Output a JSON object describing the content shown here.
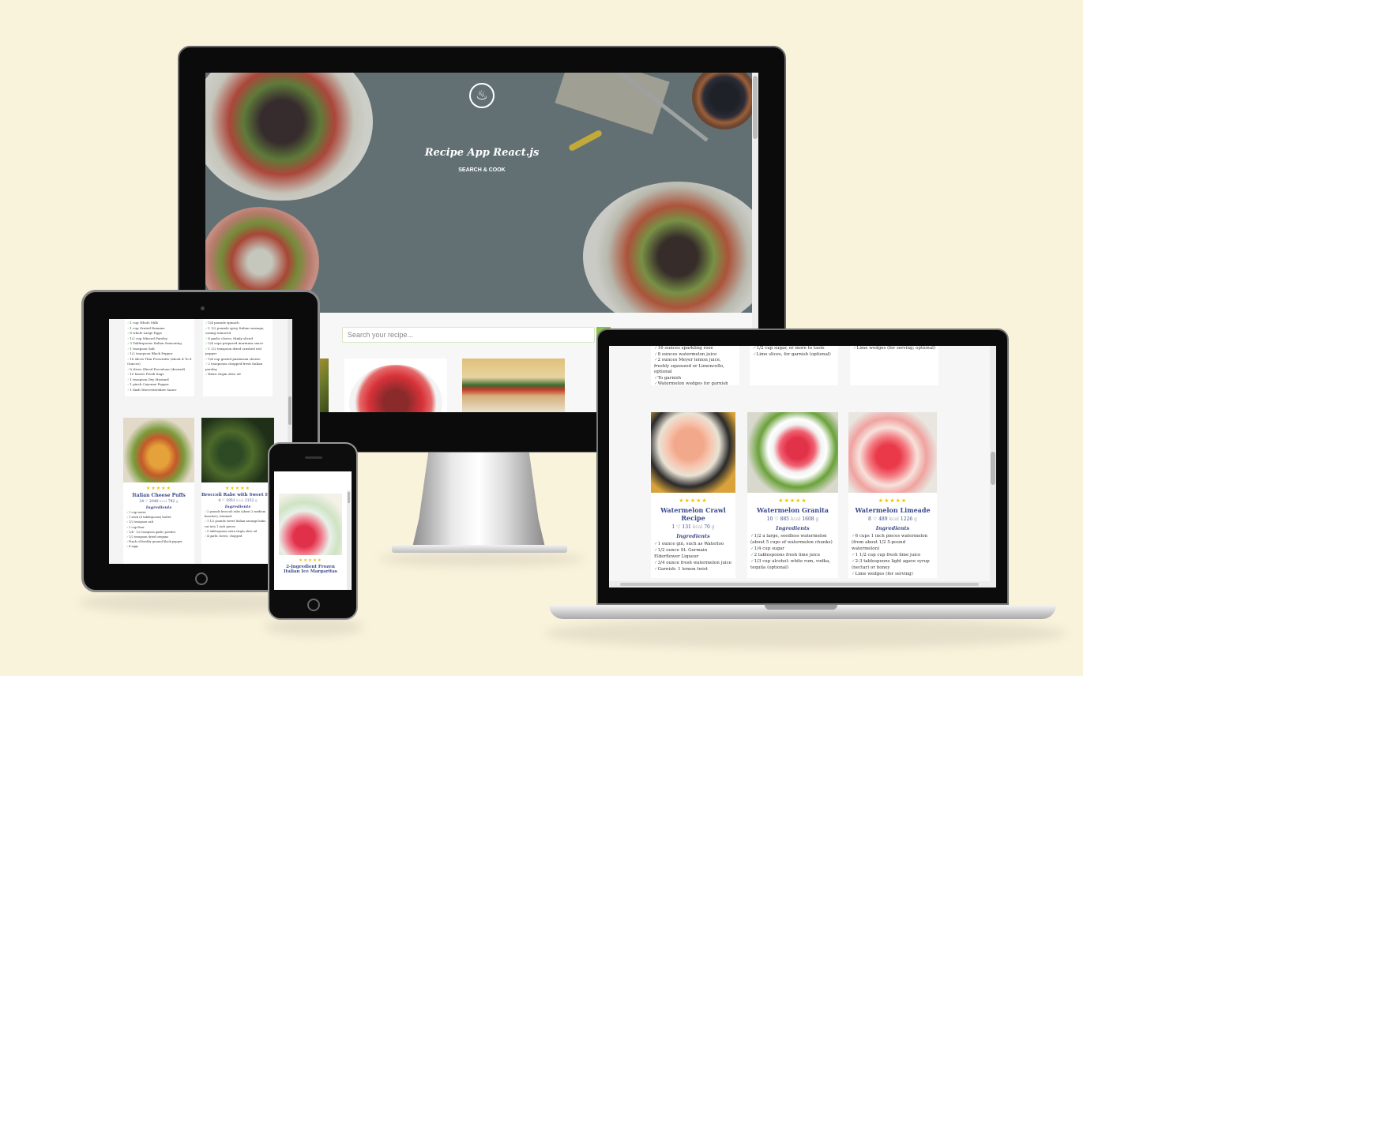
{
  "app": {
    "title": "Recipe App React.js",
    "subtitle": "SEARCH & COOK",
    "logo_icon": "fork-knife-icon"
  },
  "search": {
    "placeholder": "Search your recipe..."
  },
  "colors": {
    "background": "#faf3dc",
    "accent": "#8bc34a",
    "title_color": "#3b4a8a",
    "star_color": "#f2c200",
    "check_color": "#5cb85c"
  },
  "common": {
    "stars": "★★★★★",
    "ingredients_heading": "Ingredients",
    "cal_label": "kcal",
    "unit": "g",
    "heart": "♡"
  },
  "laptop": {
    "top_cards": [
      [
        "16 ounces sparkling rosé",
        "8 ounces watermelon juice",
        "2 ounces Meyer lemon juice, freshly squeezed or Limoncello, optional",
        "To garnish",
        "Watermelon wedges for garnish"
      ],
      [
        "1/2 cup sugar, or more to taste",
        "Lime slices, for garnish (optional)"
      ],
      [
        "Lime wedges (for serving; optional)"
      ]
    ],
    "recipes": [
      {
        "title": "Watermelon Crawl Recipe",
        "servings": "1",
        "likes": "131",
        "kcal": "70",
        "ingredients": [
          "1 ounce gin, such as Waterloo",
          "1/2 ounce St. Germain Elderflower Liqueur",
          "3/4 ounce fresh watermelon juice",
          "Garnish: 1 lemon twist"
        ]
      },
      {
        "title": "Watermelon Granita",
        "servings": "10",
        "likes": "885",
        "kcal": "1608",
        "ingredients": [
          "1/2 a large, seedless watermelon (about 5 cups of watermelon chunks)",
          "1/4 cup sugar",
          "2 tablespoons fresh lime juice",
          "1/3 cup alcohol: white rum, vodka, tequila (optional)"
        ]
      },
      {
        "title": "Watermelon Limeade",
        "servings": "8",
        "likes": "489",
        "kcal": "1226",
        "ingredients": [
          "6 cups 1 inch pieces watermelon (from about 1/2 5-pound watermelon)",
          "1 1/2 cup cup fresh lime juice",
          "2-3 tablespoons light agave syrup (nectar) or honey",
          "Lime wedges (for serving)"
        ]
      }
    ]
  },
  "ipad": {
    "top_left_list": [
      "1 cup Whole Milk",
      "1 cup Grated Romano",
      "8 whole Large Eggs",
      "1/2 cup Minced Parsley",
      "3 Tablespoons Italian Seasoning",
      "1 teaspoon Salt",
      "1/2 teaspoon Black Pepper",
      "16 slices Thin Prosciutto (about 4 To 6 Ounces)",
      "8 slices Sliced Provolone (desired)",
      "10 leaves Fresh Sage",
      "1 teaspoon Dry Mustard",
      "1 pinch Cayenne Pepper",
      "1 dash Worcestershire Sauce"
    ],
    "top_right_list": [
      "1/4 pounds spinach",
      "1 1/2 pounds spicy Italian sausage, casing removed",
      "4 garlic cloves, thinly sliced",
      "1/4 cups prepared marinara sauce",
      "1 1/2 teaspoon dried crushed red pepper",
      "1/4 cup grated parmesan cheese",
      "2 teaspoons chopped fresh Italian parsley",
      "Extra virgin olive oil"
    ],
    "recipes": [
      {
        "title": "Italian Cheese Puffs",
        "servings": "24",
        "likes": "2040",
        "kcal": "782",
        "ingredients": [
          "1 cup water",
          "1 stick (8 tablespoons) butter",
          "1/2 teaspoon salt",
          "1 cup flour",
          "1/4 - 1/2 teaspoon garlic powder",
          "1/2 teaspoon dried oregano",
          "Pinch of freshly ground black pepper",
          "4 eggs"
        ]
      },
      {
        "title": "Broccoli Rabe with Sweet Italian Sausage",
        "servings": "4",
        "likes": "1951",
        "kcal": "2152",
        "ingredients": [
          "2 pounds broccoli rabe (about 2 medium bunches), trimmed",
          "1 1/2 pounds sweet Italian sausage links, cut into 1 inch pieces",
          "5 tablespoons extra virgin olive oil",
          "4 garlic cloves, chopped"
        ]
      }
    ]
  },
  "iphone": {
    "recipe_title": "2-Ingredient Frozen Italian Ice Margaritas"
  }
}
